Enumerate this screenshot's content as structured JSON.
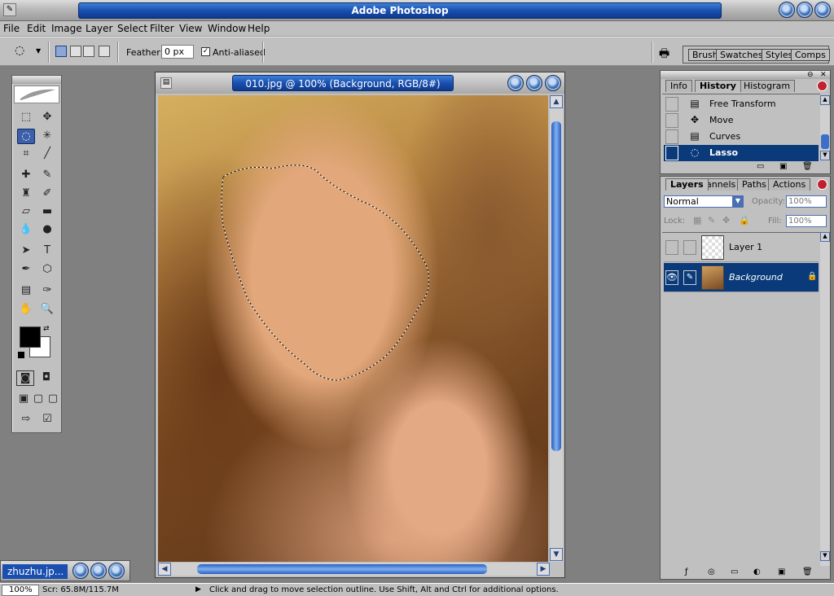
{
  "app": {
    "title": "Adobe Photoshop",
    "icon": "photoshop-app-icon"
  },
  "menu": [
    "File",
    "Edit",
    "Image",
    "Layer",
    "Select",
    "Filter",
    "View",
    "Window",
    "Help"
  ],
  "options": {
    "feather_label": "Feather:",
    "feather_value": "0 px",
    "anti_aliased_label": "Anti-aliased",
    "anti_aliased_checked": true,
    "wells": [
      "Brush",
      "Swatches",
      "Styles",
      "Comps"
    ]
  },
  "toolbox": {
    "active_tool": "lasso-tool",
    "foreground_color": "#000000",
    "background_color": "#ffffff"
  },
  "document": {
    "title": "010.jpg @ 100% (Background, RGB/8#)"
  },
  "minimized_doc": {
    "title": "zhuzhu.jp..."
  },
  "history_panel": {
    "tabs": [
      "Info",
      "History",
      "Histogram"
    ],
    "active_tab": "History",
    "items": [
      {
        "label": "Free Transform",
        "icon": "document-icon"
      },
      {
        "label": "Move",
        "icon": "move-icon"
      },
      {
        "label": "Curves",
        "icon": "document-icon"
      },
      {
        "label": "Lasso",
        "icon": "lasso-icon",
        "selected": true
      }
    ]
  },
  "layers_panel": {
    "tabs": [
      "Layers",
      "Channels",
      "Paths",
      "Actions"
    ],
    "tab_labels_visible": [
      "Layers",
      "annels",
      "Paths",
      "Actions"
    ],
    "active_tab": "Layers",
    "blend_mode": "Normal",
    "opacity_label": "Opacity:",
    "opacity_value": "100%",
    "lock_label": "Lock:",
    "fill_label": "Fill:",
    "fill_value": "100%",
    "layers": [
      {
        "name": "Layer 1",
        "visible": false
      },
      {
        "name": "Background",
        "visible": true,
        "selected": true,
        "locked": true
      }
    ]
  },
  "status": {
    "zoom": "100%",
    "scratch": "Scr: 65.8M/115.7M",
    "hint": "Click and drag to move selection outline.  Use Shift, Alt and Ctrl for additional options."
  },
  "colors": {
    "accent_blue": "#1a4fb0",
    "selection_blue": "#0a3a7a",
    "chrome_gray": "#c0c0c0"
  }
}
